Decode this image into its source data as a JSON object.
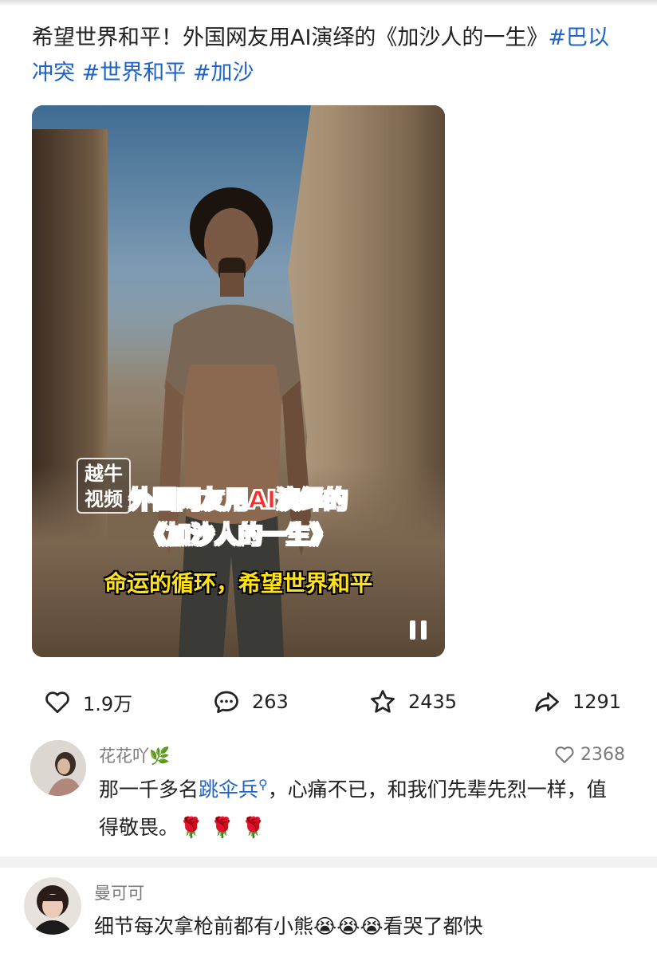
{
  "post": {
    "text_prefix": "希望世界和平！外国网友用AI演绎的《加沙人的一生》",
    "tag_1": "#巴以冲突",
    "tag_2": "#世界和平",
    "tag_3": "#加沙"
  },
  "video": {
    "watermark_line1": "越牛",
    "watermark_line2": "视频",
    "caption_line1": "外国网友用AI演绎的",
    "caption_line2": "《加沙人的一生》",
    "caption_line3": "命运的循环，希望世界和平"
  },
  "actions": {
    "likes": "1.9万",
    "comments": "263",
    "favorites": "2435",
    "shares": "1291"
  },
  "comments": [
    {
      "user": "花花吖",
      "user_badge": "🌿",
      "likes": "2368",
      "text_before_link": "那一千多名",
      "link": "跳伞兵",
      "text_after_link": "，心痛不已，和我们先辈先烈一样，值得敬畏。",
      "emojis": "🌹 🌹 🌹"
    },
    {
      "user": "曼可可",
      "text": "细节每次拿枪前都有小熊",
      "emojis": "😭😭😭",
      "text_after": "看哭了都快"
    }
  ],
  "colors": {
    "link": "#1e63c9",
    "caption_red": "#ff2b2b",
    "caption_yellow": "#ffe21a"
  }
}
